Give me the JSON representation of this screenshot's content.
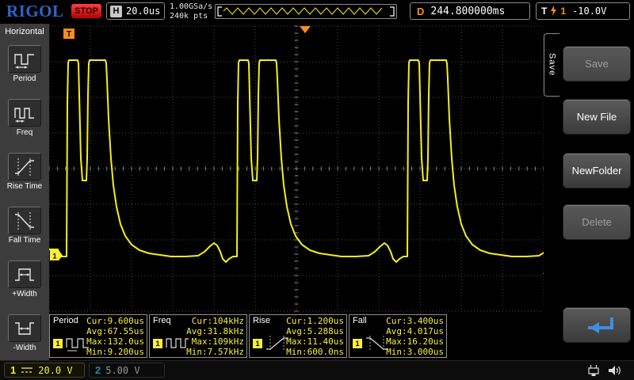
{
  "top_bar": {
    "logo": "RIGOL",
    "run_state": "STOP",
    "horizontal_label": "H",
    "timebase": "20.0us",
    "sample_rate": "1.00GSa/s",
    "memory_depth": "240k pts",
    "delay_label": "D",
    "delay_value": "244.800000ms",
    "trigger_label": "T",
    "trigger_source": "1",
    "trigger_level": "-10.0V"
  },
  "left_menu": {
    "title": "Horizontal",
    "items": [
      {
        "label": "Period"
      },
      {
        "label": "Freq"
      },
      {
        "label": "Rise Time"
      },
      {
        "label": "Fall Time"
      },
      {
        "label": "+Width"
      },
      {
        "label": "-Width"
      }
    ]
  },
  "right_menu": {
    "tab": "Save",
    "buttons": [
      {
        "label": "Save",
        "enabled": false
      },
      {
        "label": "New File",
        "enabled": true
      },
      {
        "label": "NewFolder",
        "enabled": true
      },
      {
        "label": "Delete",
        "enabled": false
      },
      {
        "label": "",
        "enabled": true
      }
    ]
  },
  "measurements": [
    {
      "name": "Period",
      "source": "1",
      "cur": "Cur:9.600us",
      "avg": "Avg:67.55us",
      "max": "Max:132.0us",
      "min": "Min:9.200us"
    },
    {
      "name": "Freq",
      "source": "1",
      "cur": "Cur:104kHz",
      "avg": "Avg:31.8kHz",
      "max": "Max:109kHz",
      "min": "Min:7.57kHz"
    },
    {
      "name": "Rise",
      "source": "1",
      "cur": "Cur:1.200us",
      "avg": "Avg:5.288us",
      "max": "Max:11.40us",
      "min": "Min:600.0ns"
    },
    {
      "name": "Fall",
      "source": "1",
      "cur": "Cur:3.400us",
      "avg": "Avg:4.017us",
      "max": "Max:16.20us",
      "min": "Min:3.000us"
    }
  ],
  "channels": [
    {
      "id": "1",
      "scale": "20.0 V",
      "active": true,
      "color": "#f8ef3a"
    },
    {
      "id": "2",
      "scale": "5.00 V",
      "active": false,
      "color": "#2f7fa8"
    }
  ],
  "markers": {
    "trigger_time_label": "T",
    "trigger_level_label": "T",
    "channel1_label": "1"
  },
  "colors": {
    "waveform": "#f5ef1a",
    "accent_orange": "#ff8c1a",
    "stop_red": "#d40000"
  },
  "waveform": {
    "lead_in": [
      [
        62,
        315
      ],
      [
        73,
        315
      ],
      [
        75,
        324
      ],
      [
        84,
        324
      ]
    ],
    "period_starts": [
      84,
      299,
      514
    ],
    "template": [
      [
        0,
        324
      ],
      [
        1,
        130
      ],
      [
        2,
        79
      ],
      [
        3,
        76
      ],
      [
        14,
        76
      ],
      [
        15,
        80
      ],
      [
        16,
        120
      ],
      [
        18,
        200
      ],
      [
        20,
        228
      ],
      [
        25,
        228
      ],
      [
        26,
        200
      ],
      [
        27,
        120
      ],
      [
        28,
        80
      ],
      [
        29,
        76
      ],
      [
        49,
        76
      ],
      [
        50,
        80
      ],
      [
        51,
        100
      ],
      [
        53,
        150
      ],
      [
        56,
        200
      ],
      [
        59,
        234
      ],
      [
        63,
        261
      ],
      [
        68,
        283
      ],
      [
        74,
        298
      ],
      [
        82,
        309
      ],
      [
        92,
        316
      ],
      [
        104,
        320
      ],
      [
        118,
        322
      ],
      [
        132,
        324
      ],
      [
        150,
        324
      ],
      [
        166,
        323
      ],
      [
        174,
        318
      ],
      [
        181,
        311
      ],
      [
        186,
        307
      ],
      [
        190,
        310
      ],
      [
        194,
        318
      ],
      [
        197,
        327
      ],
      [
        201,
        331
      ],
      [
        205,
        327
      ],
      [
        210,
        324
      ],
      [
        215,
        324
      ]
    ]
  }
}
